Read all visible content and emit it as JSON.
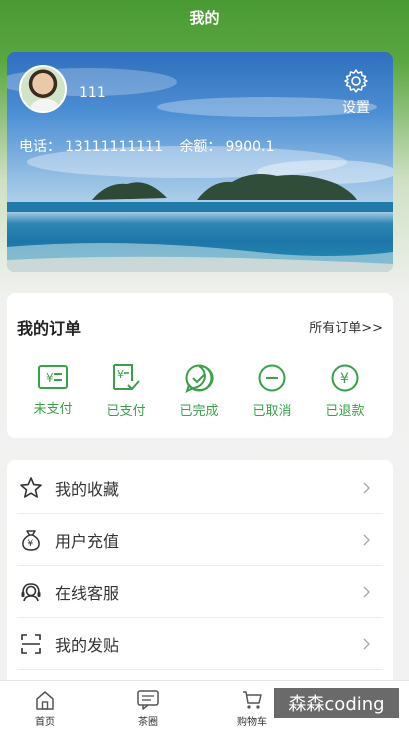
{
  "header": {
    "title": "我的"
  },
  "profile": {
    "username": "111",
    "settings_label": "设置",
    "phone_label": "电话：",
    "phone": "13111111111",
    "balance_label": "余额：",
    "balance": "9900.1"
  },
  "orders": {
    "title": "我的订单",
    "all_label": "所有订单>>",
    "accent": "#3aa04a",
    "items": [
      {
        "label": "未支付",
        "icon": "unpaid-icon"
      },
      {
        "label": "已支付",
        "icon": "paid-icon"
      },
      {
        "label": "已完成",
        "icon": "completed-icon"
      },
      {
        "label": "已取消",
        "icon": "cancelled-icon"
      },
      {
        "label": "已退款",
        "icon": "refunded-icon"
      }
    ]
  },
  "menu": {
    "items": [
      {
        "label": "我的收藏",
        "icon": "star-icon"
      },
      {
        "label": "用户充值",
        "icon": "money-bag-icon"
      },
      {
        "label": "在线客服",
        "icon": "headset-icon"
      },
      {
        "label": "我的发贴",
        "icon": "scan-frame-icon"
      }
    ]
  },
  "tabbar": {
    "items": [
      {
        "label": "首页",
        "icon": "home-icon"
      },
      {
        "label": "茶圈",
        "icon": "chat-icon"
      },
      {
        "label": "购物车",
        "icon": "cart-icon"
      }
    ]
  },
  "watermark": "森森coding"
}
